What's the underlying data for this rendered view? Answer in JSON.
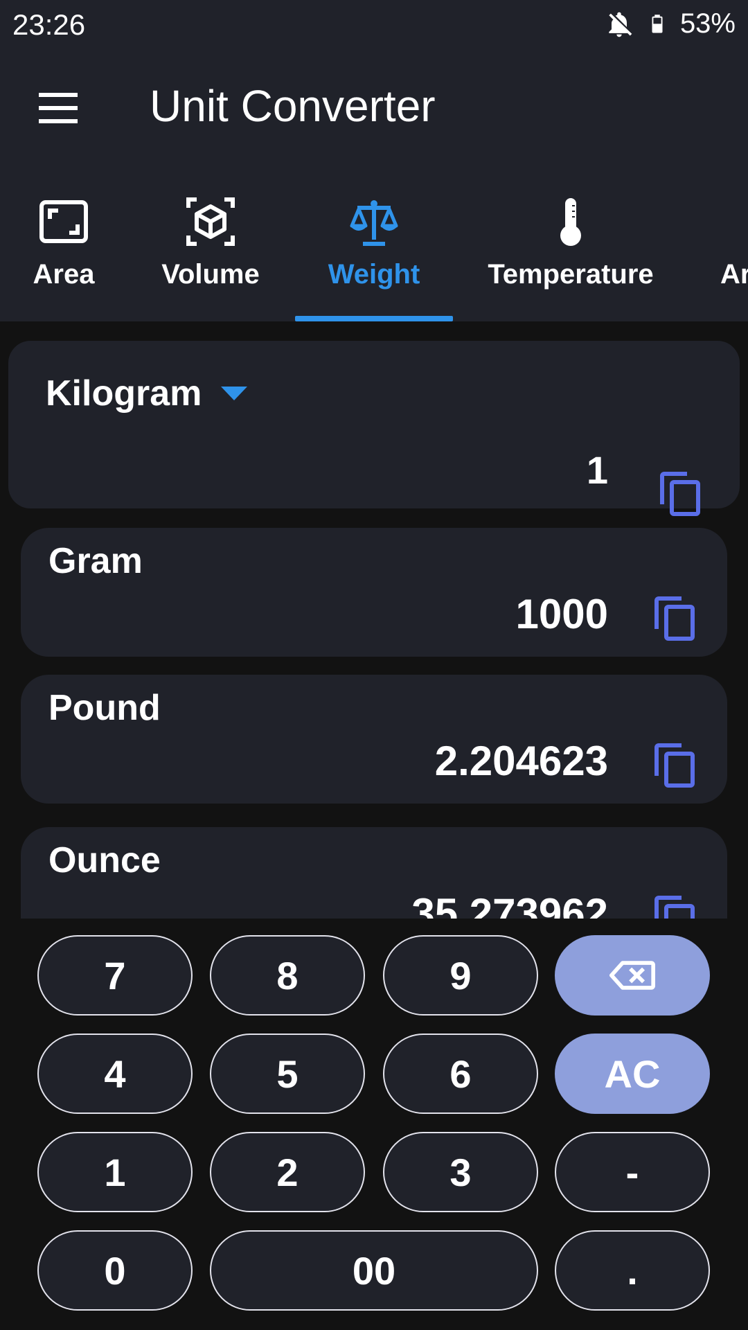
{
  "status_bar": {
    "time": "23:26",
    "battery_percent": "53%",
    "icons": [
      "notifications-off-icon",
      "battery-icon"
    ]
  },
  "app_bar": {
    "title": "Unit Converter",
    "menu_icon": "menu-icon"
  },
  "tabs": [
    {
      "label": "Area",
      "icon": "area-icon",
      "active": false
    },
    {
      "label": "Volume",
      "icon": "cube-icon",
      "active": false
    },
    {
      "label": "Weight",
      "icon": "scale-icon",
      "active": true
    },
    {
      "label": "Temperature",
      "icon": "thermometer-icon",
      "active": false
    },
    {
      "label": "Ar",
      "icon": "",
      "active": false
    }
  ],
  "converter": {
    "from_unit": "Kilogram",
    "input_value": "1",
    "results": [
      {
        "unit": "Gram",
        "value": "1000"
      },
      {
        "unit": "Pound",
        "value": "2.204623"
      },
      {
        "unit": "Ounce",
        "value": "35.273962"
      }
    ]
  },
  "keypad": {
    "keys": [
      "7",
      "8",
      "9",
      "4",
      "5",
      "6",
      "AC",
      "1",
      "2",
      "3",
      "-",
      "0",
      "00",
      "."
    ],
    "backspace_icon": "backspace-icon"
  },
  "colors": {
    "accent": "#2f93ea",
    "surface": "#20222a",
    "background": "#121212",
    "key_accent": "#8e9fdc",
    "copy_icon": "#5a6ee8"
  }
}
